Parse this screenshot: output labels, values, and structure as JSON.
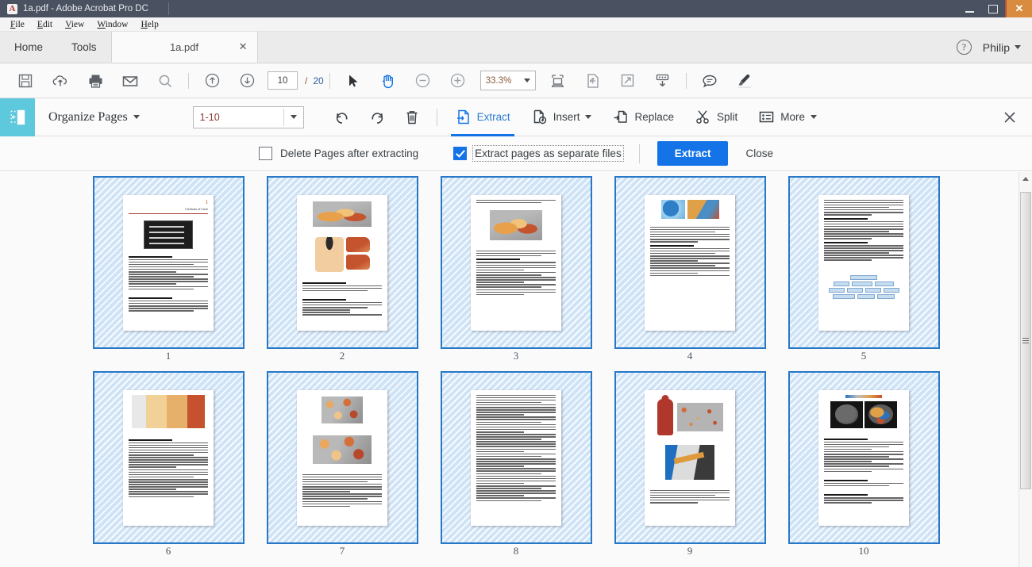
{
  "window": {
    "title": "1a.pdf - Adobe Acrobat Pro DC",
    "app_icon": "acrobat-logo",
    "minimize_label": "",
    "maximize_label": "",
    "close_label": "✕",
    "titlebar_color": "#4a5160",
    "close_button_color": "#d98c40"
  },
  "menubar": {
    "items": [
      {
        "label": "File"
      },
      {
        "label": "Edit"
      },
      {
        "label": "View"
      },
      {
        "label": "Window"
      },
      {
        "label": "Help"
      }
    ]
  },
  "tabstrip": {
    "nav": [
      {
        "label": "Home",
        "name": "tab-home"
      },
      {
        "label": "Tools",
        "name": "tab-tools"
      }
    ],
    "document_tab": {
      "label": "1a.pdf",
      "close": "✕"
    },
    "help_icon": "question-mark-icon",
    "user": {
      "label": "Philip"
    }
  },
  "toolbar": {
    "icons": [
      {
        "name": "save-icon",
        "title": "Save"
      },
      {
        "name": "cloud-upload-icon",
        "title": "Save to cloud"
      },
      {
        "name": "print-icon",
        "title": "Print"
      },
      {
        "name": "email-icon",
        "title": "Email"
      },
      {
        "name": "search-icon",
        "title": "Find"
      }
    ],
    "page_prev_icon": "arrow-up-circle-icon",
    "page_next_icon": "arrow-down-circle-icon",
    "page_current": "10",
    "page_separator": "/",
    "page_total": "20",
    "select_tool_icon": "cursor-arrow-icon",
    "hand_tool_icon": "hand-icon",
    "zoom_out_icon": "minus-circle-icon",
    "zoom_in_icon": "plus-circle-icon",
    "zoom_value": "33.3%",
    "fit_width_icon": "fit-width-icon",
    "fit_page_icon": "fit-page-icon",
    "full_screen_icon": "expand-icon",
    "scroll_mode_icon": "scroll-down-icon",
    "comment_icon": "comment-bubble-icon",
    "highlight_icon": "highlighter-icon",
    "accent_blue": "#1473e6"
  },
  "organize_bar": {
    "badge_icon": "organize-pages-icon",
    "badge_color": "#5ec8dd",
    "title": "Organize Pages",
    "page_range_value": "1-10",
    "actions": [
      {
        "label": "",
        "icon": "rotate-counterclockwise-icon",
        "name": "rotate-left-button"
      },
      {
        "label": "",
        "icon": "rotate-clockwise-icon",
        "name": "rotate-right-button"
      },
      {
        "label": "",
        "icon": "trash-icon",
        "name": "delete-pages-button"
      },
      {
        "label": "Extract",
        "icon": "extract-icon",
        "name": "extract-button",
        "active": true
      },
      {
        "label": "Insert",
        "icon": "insert-icon",
        "name": "insert-button",
        "has_caret": true
      },
      {
        "label": "Replace",
        "icon": "replace-icon",
        "name": "replace-button"
      },
      {
        "label": "Split",
        "icon": "scissors-icon",
        "name": "split-button"
      },
      {
        "label": "More",
        "icon": "list-icon",
        "name": "more-button",
        "has_caret": true
      }
    ],
    "close_icon": "close-icon"
  },
  "extract_bar": {
    "delete_after_label": "Delete Pages after extracting",
    "delete_after_checked": false,
    "separate_files_label": "Extract pages as separate files",
    "separate_files_checked": true,
    "extract_button": "Extract",
    "close_link": "Close"
  },
  "pages": [
    {
      "number": "1",
      "selected": true,
      "kind": "title",
      "title": "Cirrhosis of Liver",
      "page_number_mark": "1"
    },
    {
      "number": "2",
      "selected": true,
      "kind": "anatomy"
    },
    {
      "number": "3",
      "selected": true,
      "kind": "anatomy2"
    },
    {
      "number": "4",
      "selected": true,
      "kind": "figures-text"
    },
    {
      "number": "5",
      "selected": true,
      "kind": "text-flowchart"
    },
    {
      "number": "6",
      "selected": true,
      "kind": "table-text"
    },
    {
      "number": "7",
      "selected": true,
      "kind": "micrographs"
    },
    {
      "number": "8",
      "selected": true,
      "kind": "text-only"
    },
    {
      "number": "9",
      "selected": true,
      "kind": "silhouette"
    },
    {
      "number": "10",
      "selected": true,
      "kind": "ct-scan"
    }
  ],
  "selection": {
    "border_color": "#2878c8",
    "fill_color": "#cfe3f7"
  },
  "scrollbar": {
    "up_arrow_icon": "scroll-up-arrow-icon",
    "grip_icon": "scrollbar-grip-icon"
  }
}
